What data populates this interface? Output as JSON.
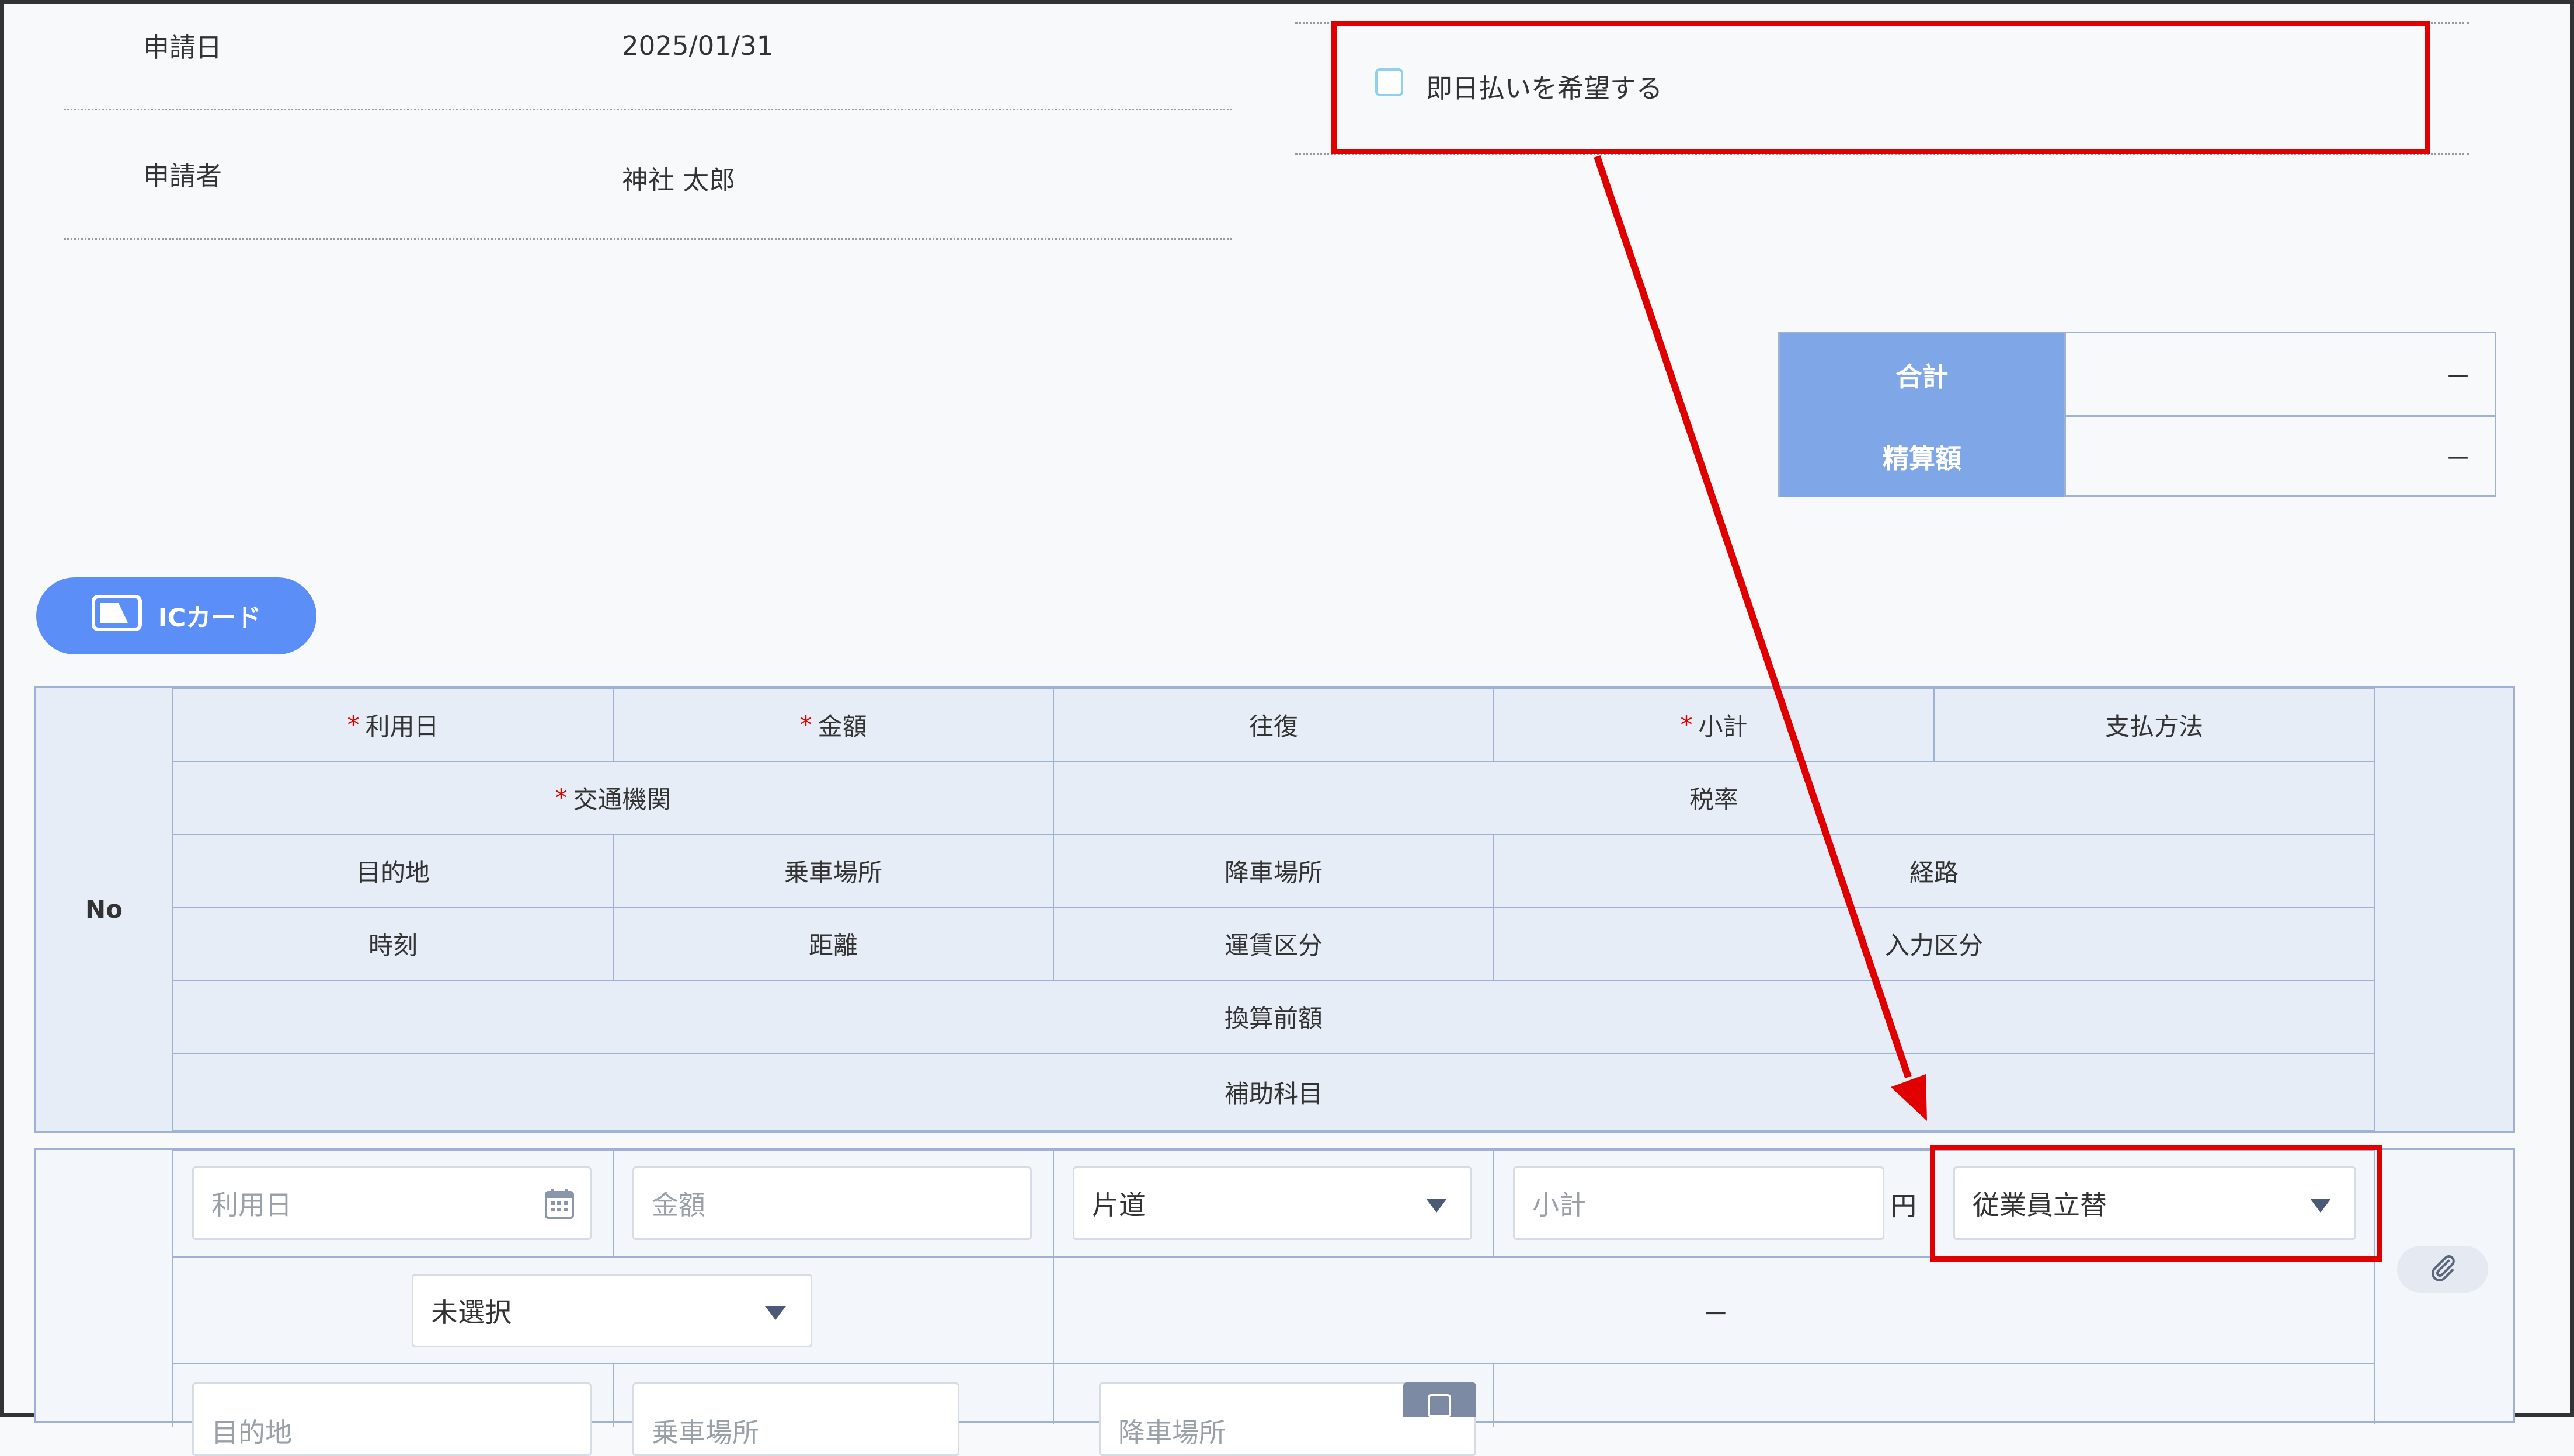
{
  "header": {
    "date_label": "申請日",
    "date_value": "2025/01/31",
    "applicant_label": "申請者",
    "applicant_value": "神社 太郎",
    "same_day_label": "即日払いを希望する"
  },
  "summary": {
    "total_label": "合計",
    "total_value": "－",
    "settlement_label": "精算額",
    "settlement_value": "－"
  },
  "ic_card_button": "ICカード",
  "table_header": {
    "no": "No",
    "use_date": "利用日",
    "amount": "金額",
    "round_trip": "往復",
    "subtotal": "小計",
    "payment_method": "支払方法",
    "transport": "交通機関",
    "tax_rate": "税率",
    "destination": "目的地",
    "boarding": "乗車場所",
    "alighting": "降車場所",
    "route": "経路",
    "time": "時刻",
    "distance": "距離",
    "fare_type": "運賃区分",
    "input_type": "入力区分",
    "pre_conversion": "換算前額",
    "sub_account": "補助科目",
    "required_mark": "*"
  },
  "row": {
    "use_date_placeholder": "利用日",
    "amount_placeholder": "金額",
    "round_trip_value": "片道",
    "subtotal_placeholder": "小計",
    "yen": "円",
    "payment_value": "従業員立替",
    "transport_value": "未選択",
    "tax_rate_value": "－",
    "destination_placeholder": "目的地",
    "boarding_placeholder": "乗車場所",
    "alighting_placeholder": "降車場所"
  },
  "colors": {
    "highlight": "#e00000",
    "header_blue": "#7fa7e8",
    "button_blue": "#5b8ff7"
  }
}
